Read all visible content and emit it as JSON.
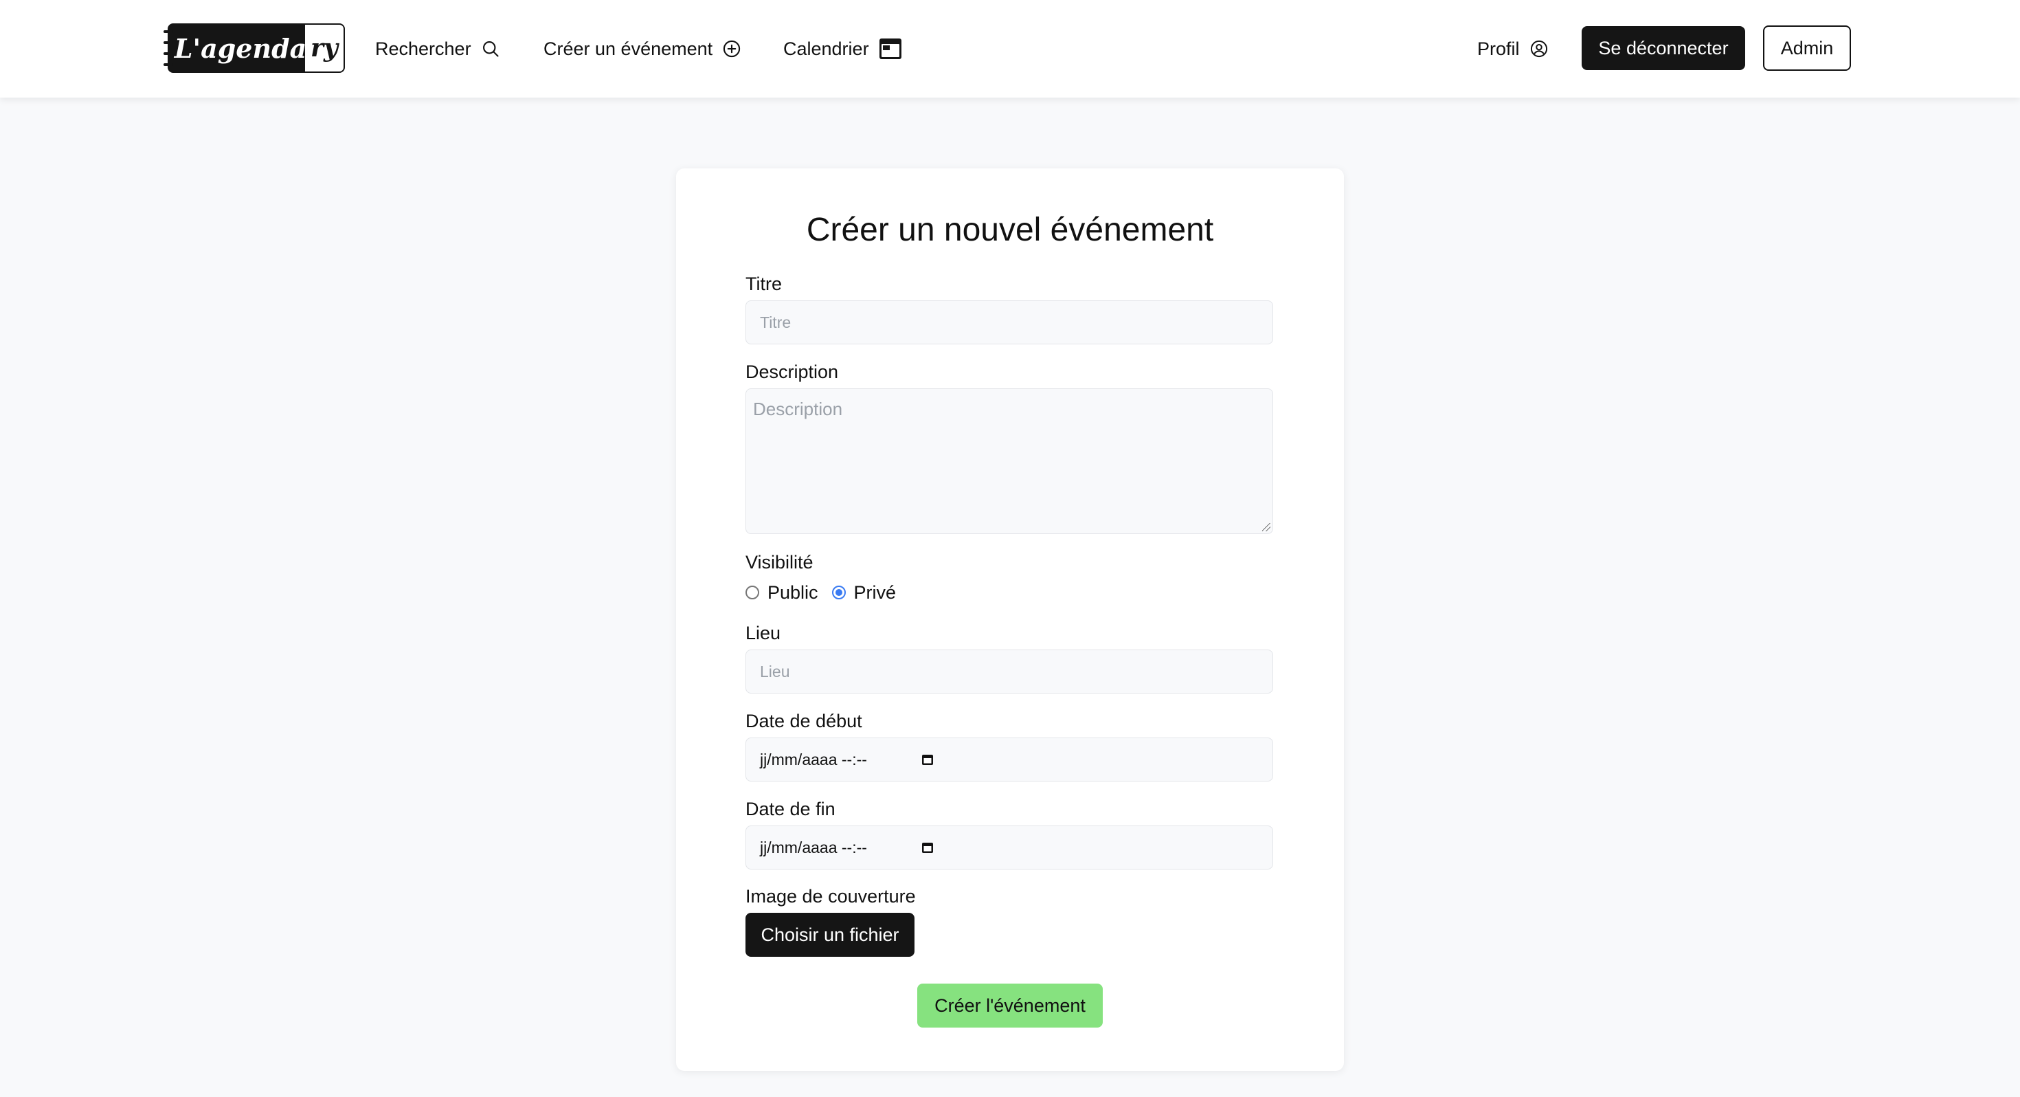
{
  "header": {
    "logo": {
      "left_text": "L'agenda",
      "right_text": "ry"
    },
    "nav": {
      "search_label": "Rechercher",
      "create_label": "Créer un événement",
      "calendar_label": "Calendrier",
      "profile_label": "Profil"
    },
    "logout_label": "Se déconnecter",
    "admin_label": "Admin"
  },
  "form": {
    "title": "Créer un nouvel événement",
    "titre": {
      "label": "Titre",
      "placeholder": "Titre",
      "value": ""
    },
    "description": {
      "label": "Description",
      "placeholder": "Description",
      "value": ""
    },
    "visibility": {
      "label": "Visibilité",
      "options": [
        "Public",
        "Privé"
      ],
      "selected": "Privé"
    },
    "lieu": {
      "label": "Lieu",
      "placeholder": "Lieu",
      "value": ""
    },
    "start_date": {
      "label": "Date de début",
      "display": "jj/mm/aaaa  --:--"
    },
    "end_date": {
      "label": "Date de fin",
      "display": "jj/mm/aaaa  --:--"
    },
    "cover_image": {
      "label": "Image de couverture",
      "button_label": "Choisir un fichier"
    },
    "submit_label": "Créer l'événement"
  },
  "colors": {
    "background": "#f8f9fb",
    "dark": "#151515",
    "submit": "#86e27f",
    "radio_accent": "#3a7bf2"
  },
  "icons": {
    "search": "search-icon",
    "create": "plus-circle-icon",
    "calendar": "calendar-icon",
    "profile": "user-circle-icon",
    "date_picker": "calendar-small-icon"
  }
}
